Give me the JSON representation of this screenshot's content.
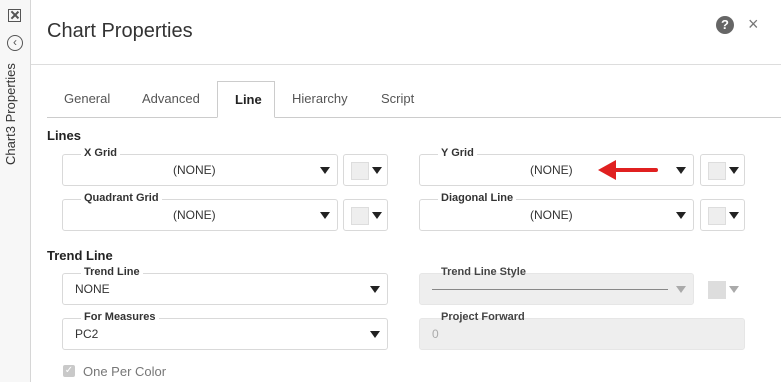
{
  "sidebar": {
    "label": "Chart3 Properties"
  },
  "header": {
    "title": "Chart Properties",
    "help": "?",
    "close": "×"
  },
  "tabs": [
    {
      "label": "General"
    },
    {
      "label": "Advanced"
    },
    {
      "label": "Line"
    },
    {
      "label": "Hierarchy"
    },
    {
      "label": "Script"
    }
  ],
  "lines_section": {
    "heading": "Lines",
    "x_grid": {
      "label": "X Grid",
      "value": "(NONE)"
    },
    "y_grid": {
      "label": "Y Grid",
      "value": "(NONE)"
    },
    "quadrant_grid": {
      "label": "Quadrant Grid",
      "value": "(NONE)"
    },
    "diagonal_line": {
      "label": "Diagonal Line",
      "value": "(NONE)"
    }
  },
  "trend_section": {
    "heading": "Trend Line",
    "trend_line": {
      "label": "Trend Line",
      "value": "NONE"
    },
    "trend_line_style": {
      "label": "Trend Line Style"
    },
    "for_measures": {
      "label": "For Measures",
      "value": "PC2"
    },
    "project_forward": {
      "label": "Project Forward",
      "value": "0"
    },
    "one_per_color": {
      "label": "One Per Color"
    }
  },
  "colors": {
    "annotation_arrow": "#e02020"
  }
}
